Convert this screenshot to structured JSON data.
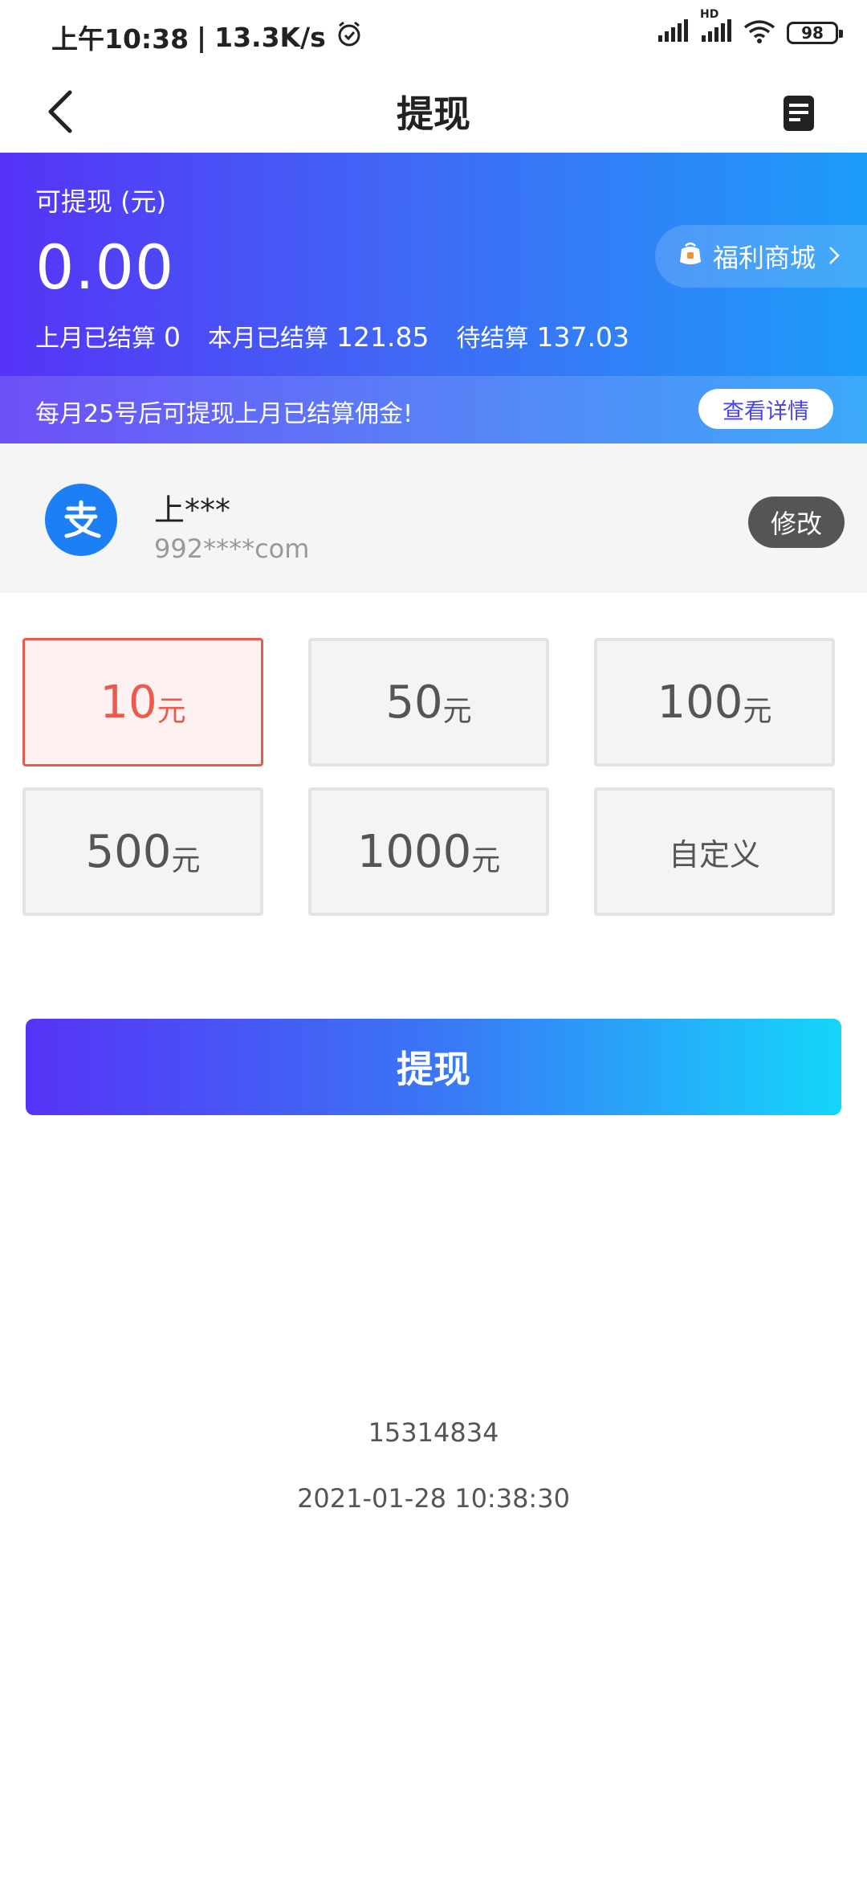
{
  "status_bar": {
    "time": "上午10:38",
    "separator": "|",
    "speed": "13.3K/s",
    "hd_label": "HD",
    "battery": "98"
  },
  "nav": {
    "title": "提现"
  },
  "balance": {
    "label": "可提现 (元)",
    "amount": "0.00",
    "last_month_label": "上月已结算",
    "last_month_value": "0",
    "this_month_label": "本月已结算",
    "this_month_value": "121.85",
    "pending_label": "待结算",
    "pending_value": "137.03",
    "mall_label": "福利商城",
    "notice": "每月25号后可提现上月已结算佣金!",
    "detail_label": "查看详情"
  },
  "account": {
    "name": "上***",
    "id": "992****com",
    "modify_label": "修改"
  },
  "options": [
    {
      "value": "10",
      "unit": "元",
      "selected": true
    },
    {
      "value": "50",
      "unit": "元",
      "selected": false
    },
    {
      "value": "100",
      "unit": "元",
      "selected": false
    },
    {
      "value": "500",
      "unit": "元",
      "selected": false
    },
    {
      "value": "1000",
      "unit": "元",
      "selected": false
    },
    {
      "custom_label": "自定义",
      "selected": false
    }
  ],
  "withdraw_label": "提现",
  "footer": {
    "id": "15314834",
    "timestamp": "2021-01-28 10:38:30"
  },
  "colors": {
    "accent_start": "#5633f7",
    "accent_end": "#14d6fb",
    "selected": "#ec5a4c",
    "alipay_blue": "#1c7ff5"
  }
}
